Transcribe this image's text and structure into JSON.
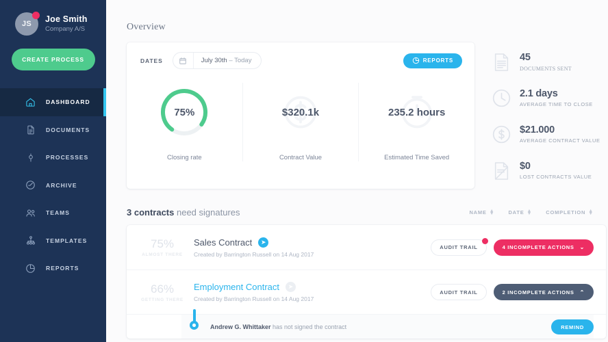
{
  "sidebar": {
    "user": {
      "initials": "JS",
      "name": "Joe Smith",
      "company": "Company A/S",
      "notification_dot_color": "#ed2e63"
    },
    "create_button": "CREATE PROCESS",
    "items": [
      {
        "label": "DASHBOARD",
        "icon": "home-icon",
        "active": true
      },
      {
        "label": "DOCUMENTS",
        "icon": "document-icon",
        "active": false
      },
      {
        "label": "PROCESSES",
        "icon": "process-icon",
        "active": false
      },
      {
        "label": "ARCHIVE",
        "icon": "archive-clock-icon",
        "active": false
      },
      {
        "label": "TEAMS",
        "icon": "teams-icon",
        "active": false
      },
      {
        "label": "TEMPLATES",
        "icon": "templates-hierarchy-icon",
        "active": false
      },
      {
        "label": "REPORTS",
        "icon": "reports-piechart-icon",
        "active": false
      }
    ],
    "bg_color": "#1d3356",
    "active_bar_color": "#34c6f0"
  },
  "header": {
    "title": "Overview"
  },
  "overview": {
    "dates_label": "DATES",
    "calendar_icon": "calendar-icon",
    "date_value": "July 30th",
    "date_value_suffix": " – Today",
    "reports_button": "REPORTS",
    "reports_icon": "piechart-icon",
    "reports_color": "#2ab4ec",
    "stats": [
      {
        "type": "donut",
        "value": "75%",
        "caption": "Closing rate",
        "percent": 75,
        "ring_color": "#4ecb8d",
        "track_color": "#edf1f3",
        "ghost_icon": ""
      },
      {
        "type": "plain",
        "value": "$320.1k",
        "caption": "Contract Value",
        "ghost_icon": "dollar-ghost-icon"
      },
      {
        "type": "plain",
        "value": "235.2 hours",
        "caption": "Estimated Time Saved",
        "ghost_icon": "clock-ghost-icon"
      }
    ]
  },
  "metrics": [
    {
      "value": "45",
      "label": "DOCUMENTS SENT",
      "icon": "document-lines-icon",
      "serif": true
    },
    {
      "value": "2.1 days",
      "label": "AVERAGE TIME TO CLOSE",
      "icon": "clock-icon",
      "serif": false
    },
    {
      "value": "$21.000",
      "label": "AVERAGE CONTRACT VALUE",
      "icon": "dollar-circle-icon",
      "serif": false
    },
    {
      "value": "$0",
      "label": "LOST CONTRACTS VALUE",
      "icon": "lost-document-icon",
      "serif": false
    }
  ],
  "contracts": {
    "title_strong": "3 contracts",
    "title_rest": " need signatures",
    "sorts": [
      {
        "label": "NAME"
      },
      {
        "label": "DATE"
      },
      {
        "label": "COMPLETION"
      }
    ],
    "rows": [
      {
        "percent": "75%",
        "percent_caption": "ALMOST THERE",
        "name": "Sales Contract",
        "name_is_link": false,
        "go_icon": "arrow-right-circle-icon",
        "go_active": true,
        "meta": "Created by Barrington Russell on 14 Aug 2017",
        "audit_label": "AUDIT TRAIL",
        "audit_has_dot": true,
        "action_label": "4 INCOMPLETE ACTIONS",
        "action_caret": "⌄",
        "action_style": "danger"
      },
      {
        "percent": "66%",
        "percent_caption": "GETTING THERE",
        "name": "Employment Contract",
        "name_is_link": true,
        "go_icon": "arrow-right-circle-icon",
        "go_active": false,
        "meta": "Created by Barrington Russell on 14 Aug 2017",
        "audit_label": "AUDIT TRAIL",
        "audit_has_dot": false,
        "action_label": "2 INCOMPLETE ACTIONS",
        "action_caret": "⌃",
        "action_style": "dark"
      }
    ],
    "expanded": {
      "pin_icon": "location-pin-icon",
      "text_strong": "Andrew G. Whittaker",
      "text_rest": " has not signed the contract",
      "button_label": "REMIND"
    }
  }
}
